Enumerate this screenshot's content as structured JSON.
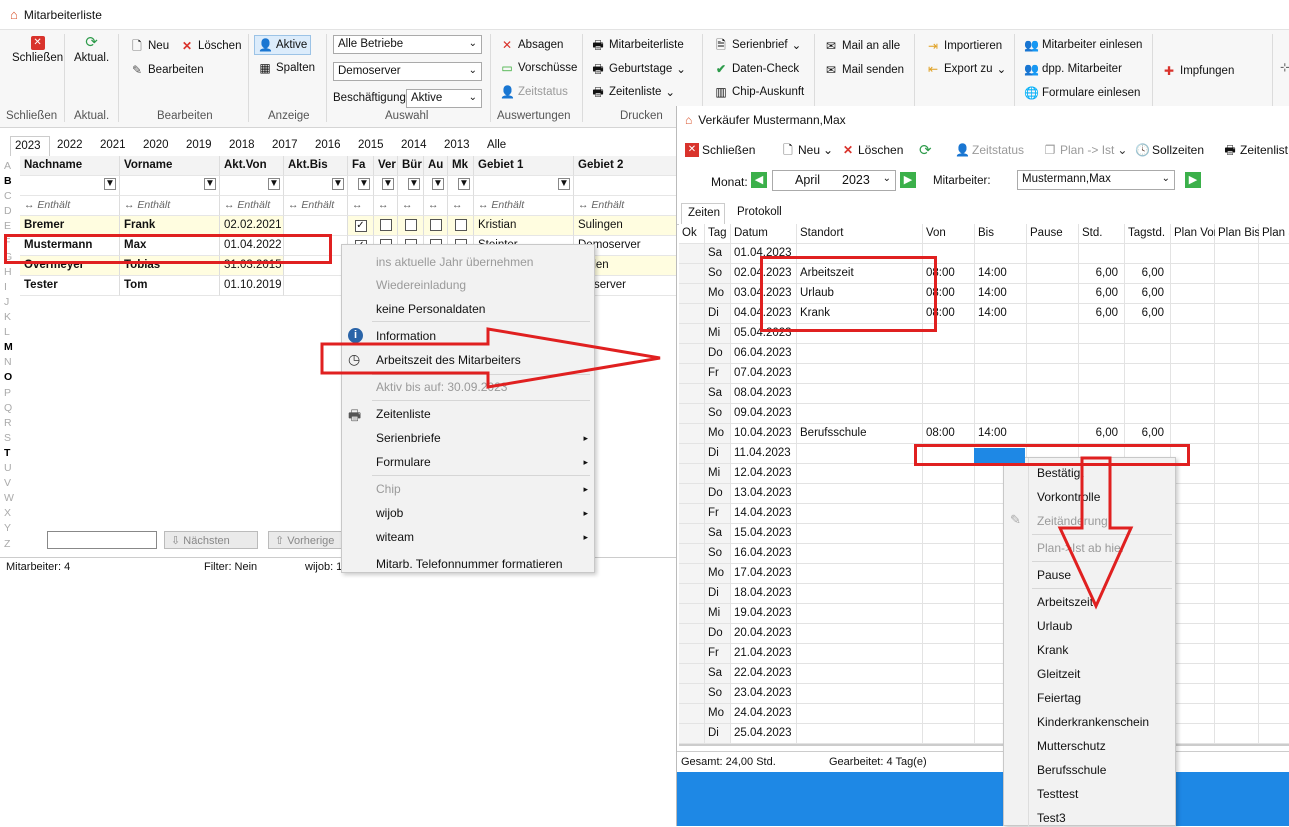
{
  "window": {
    "title": "Mitarbeiterliste"
  },
  "ribbon": {
    "close_label": "Schließen",
    "refresh_label": "Aktual.",
    "new_label": "Neu",
    "delete_label": "Löschen",
    "edit_label": "Bearbeiten",
    "active_label": "Aktive",
    "columns_label": "Spalten",
    "betriebe_value": "Alle Betriebe",
    "server_value": "Demoserver",
    "employment_label": "Beschäftigung",
    "employment_value": "Aktive",
    "absagen_label": "Absagen",
    "vorschuesse_label": "Vorschüsse",
    "zeitstatus_label": "Zeitstatus",
    "mitarbeiterliste_label": "Mitarbeiterliste",
    "geburtstage_label": "Geburtstage",
    "zeitenliste_label": "Zeitenliste",
    "serienbrief_label": "Serienbrief",
    "datencheck_label": "Daten-Check",
    "chipauskunft_label": "Chip-Auskunft",
    "mail_all_label": "Mail an alle",
    "mail_send_label": "Mail senden",
    "import_label": "Importieren",
    "export_label": "Export zu",
    "einlesen_label": "Mitarbeiter einlesen",
    "dpp_label": "dpp. Mitarbeiter",
    "formulare_label": "Formulare einlesen",
    "impfungen_label": "Impfungen",
    "groups": [
      "Schließen",
      "Aktual.",
      "Bearbeiten",
      "Anzeige",
      "Auswahl",
      "Auswertungen",
      "Drucken"
    ]
  },
  "years": [
    "2023",
    "2022",
    "2021",
    "2020",
    "2019",
    "2018",
    "2017",
    "2016",
    "2015",
    "2014",
    "2013",
    "Alle"
  ],
  "alphabet": [
    "A",
    "B",
    "C",
    "D",
    "E",
    "F",
    "G",
    "H",
    "I",
    "J",
    "K",
    "L",
    "M",
    "N",
    "O",
    "P",
    "Q",
    "R",
    "S",
    "T",
    "U",
    "V",
    "W",
    "X",
    "Y",
    "Z"
  ],
  "table": {
    "headers": [
      "Nachname",
      "Vorname",
      "Akt.Von",
      "Akt.Bis",
      "Fa",
      "Ver",
      "Bür",
      "Au",
      "Mk",
      "Gebiet 1",
      "Gebiet 2"
    ],
    "filter_text": "Enthält",
    "rows": [
      {
        "nachname": "Bremer",
        "vorname": "Frank",
        "von": "02.02.2021",
        "bis": "",
        "g1": "Kristian",
        "g2": "Sulingen"
      },
      {
        "nachname": "Mustermann",
        "vorname": "Max",
        "von": "01.04.2022",
        "bis": "",
        "g1": "Steinter",
        "g2": "Demoserver"
      },
      {
        "nachname": "Overmeyer",
        "vorname": "Tobias",
        "von": "31.03.2015",
        "bis": "",
        "g1": "",
        "g2": "lladen"
      },
      {
        "nachname": "Tester",
        "vorname": "Tom",
        "von": "01.10.2019",
        "bis": "",
        "g1": "",
        "g2": "moserver"
      }
    ]
  },
  "bottom": {
    "next_label": "Nächsten",
    "prev_label": "Vorherige",
    "count": "Mitarbeiter: 4",
    "filter": "Filter: Nein",
    "wijob": "wijob: 1"
  },
  "context_menu": {
    "items": [
      "ins aktuelle Jahr übernehmen",
      "Wiedereinladung",
      "keine Personaldaten",
      "Information",
      "Arbeitszeit des Mitarbeiters",
      "Aktiv bis auf: 30.09.2023",
      "Zeitenliste",
      "Serienbriefe",
      "Formulare",
      "Chip",
      "wijob",
      "witeam",
      "Mitarb. Telefonnummer formatieren"
    ]
  },
  "win2": {
    "title": "Verkäufer Mustermann,Max",
    "close_label": "Schließen",
    "new_label": "Neu",
    "delete_label": "Löschen",
    "zeitstatus_label": "Zeitstatus",
    "plan_label": "Plan -> Ist",
    "sollzeiten_label": "Sollzeiten",
    "zeitenliste_label": "Zeitenlist",
    "month_label": "Monat:",
    "month_value": "April",
    "year_value": "2023",
    "employee_label": "Mitarbeiter:",
    "employee_value": "Mustermann,Max",
    "tabs": [
      "Zeiten",
      "Protokoll"
    ],
    "headers": [
      "Ok",
      "Tag",
      "Datum",
      "Standort",
      "Von",
      "Bis",
      "Pause",
      "Std.",
      "Tagstd.",
      "Plan Vor",
      "Plan Bis",
      "Plan S"
    ],
    "rows": [
      [
        "Sa",
        "01.04.2023",
        "",
        "",
        "",
        "",
        "",
        ""
      ],
      [
        "So",
        "02.04.2023",
        "Arbeitszeit",
        "08:00",
        "14:00",
        "",
        "6,00",
        "6,00"
      ],
      [
        "Mo",
        "03.04.2023",
        "Urlaub",
        "08:00",
        "14:00",
        "",
        "6,00",
        "6,00"
      ],
      [
        "Di",
        "04.04.2023",
        "Krank",
        "08:00",
        "14:00",
        "",
        "6,00",
        "6,00"
      ],
      [
        "Mi",
        "05.04.2023",
        "",
        "",
        "",
        "",
        "",
        ""
      ],
      [
        "Do",
        "06.04.2023",
        "",
        "",
        "",
        "",
        "",
        ""
      ],
      [
        "Fr",
        "07.04.2023",
        "",
        "",
        "",
        "",
        "",
        ""
      ],
      [
        "Sa",
        "08.04.2023",
        "",
        "",
        "",
        "",
        "",
        ""
      ],
      [
        "So",
        "09.04.2023",
        "",
        "",
        "",
        "",
        "",
        ""
      ],
      [
        "Mo",
        "10.04.2023",
        "Berufsschule",
        "08:00",
        "14:00",
        "",
        "6,00",
        "6,00"
      ],
      [
        "Di",
        "11.04.2023",
        "",
        "",
        "",
        "",
        "",
        ""
      ],
      [
        "Mi",
        "12.04.2023",
        "",
        "",
        "",
        "",
        "",
        ""
      ],
      [
        "Do",
        "13.04.2023",
        "",
        "",
        "",
        "",
        "",
        ""
      ],
      [
        "Fr",
        "14.04.2023",
        "",
        "",
        "",
        "",
        "",
        ""
      ],
      [
        "Sa",
        "15.04.2023",
        "",
        "",
        "",
        "",
        "",
        ""
      ],
      [
        "So",
        "16.04.2023",
        "",
        "",
        "",
        "",
        "",
        ""
      ],
      [
        "Mo",
        "17.04.2023",
        "",
        "",
        "",
        "",
        "",
        ""
      ],
      [
        "Di",
        "18.04.2023",
        "",
        "",
        "",
        "",
        "",
        ""
      ],
      [
        "Mi",
        "19.04.2023",
        "",
        "",
        "",
        "",
        "",
        ""
      ],
      [
        "Do",
        "20.04.2023",
        "",
        "",
        "",
        "",
        "",
        ""
      ],
      [
        "Fr",
        "21.04.2023",
        "",
        "",
        "",
        "",
        "",
        ""
      ],
      [
        "Sa",
        "22.04.2023",
        "",
        "",
        "",
        "",
        "",
        ""
      ],
      [
        "So",
        "23.04.2023",
        "",
        "",
        "",
        "",
        "",
        ""
      ],
      [
        "Mo",
        "24.04.2023",
        "",
        "",
        "",
        "",
        "",
        ""
      ],
      [
        "Di",
        "25.04.2023",
        "",
        "",
        "",
        "",
        "",
        ""
      ]
    ],
    "total": "Gesamt: 24,00 Std.",
    "worked": "Gearbeitet: 4 Tag(e)"
  },
  "context_menu2": {
    "items": [
      "Bestätigt",
      "Vorkontrolle",
      "Zeitänderung",
      "Plan->Ist ab hier",
      "Pause",
      "Arbeitszeit",
      "Urlaub",
      "Krank",
      "Gleitzeit",
      "Feiertag",
      "Kinderkrankenschein",
      "Mutterschutz",
      "Berufsschule",
      "Testtest",
      "Test3"
    ]
  },
  "colors": {
    "highlight": "#e02020",
    "accent_blue": "#1e88e5",
    "row_yellow": "#fffde0"
  }
}
